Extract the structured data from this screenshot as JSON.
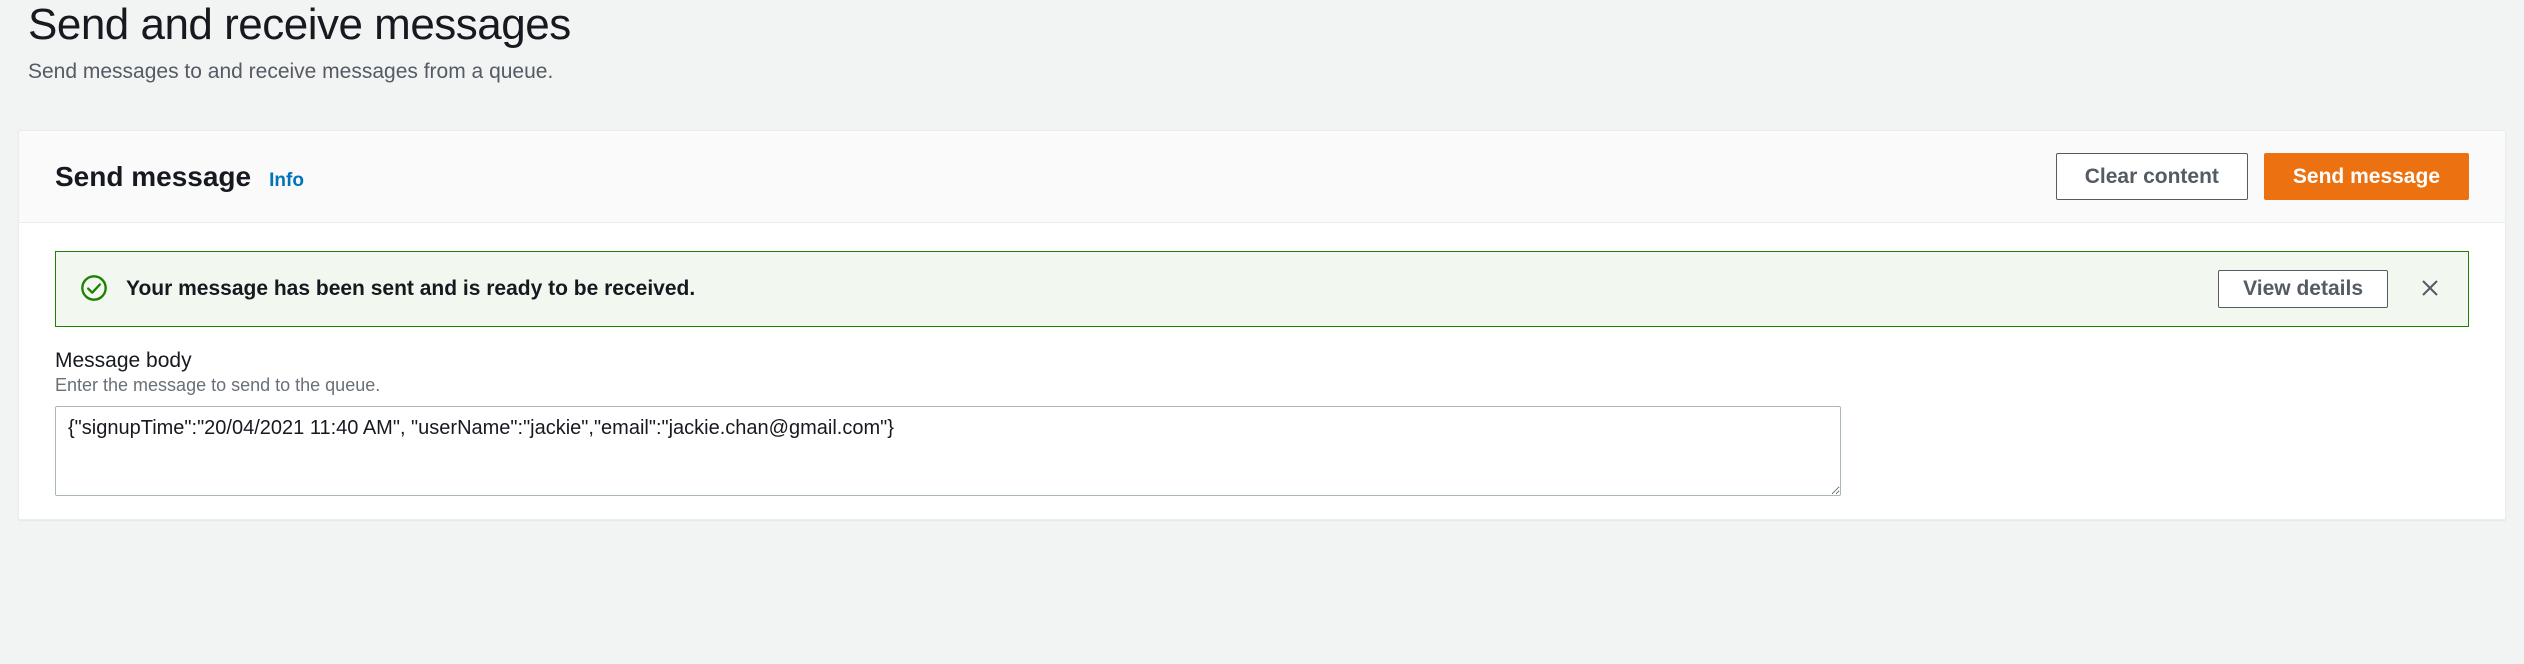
{
  "page": {
    "title": "Send and receive messages",
    "subtitle": "Send messages to and receive messages from a queue."
  },
  "panel": {
    "title": "Send message",
    "info_label": "Info",
    "actions": {
      "clear": "Clear content",
      "send": "Send message"
    }
  },
  "alert": {
    "text": "Your message has been sent and is ready to be received.",
    "view_details": "View details"
  },
  "form": {
    "message_body_label": "Message body",
    "message_body_hint": "Enter the message to send to the queue.",
    "message_body_value": "{\"signupTime\":\"20/04/2021 11:40 AM\", \"userName\":\"jackie\",\"email\":\"jackie.chan@gmail.com\"}"
  }
}
